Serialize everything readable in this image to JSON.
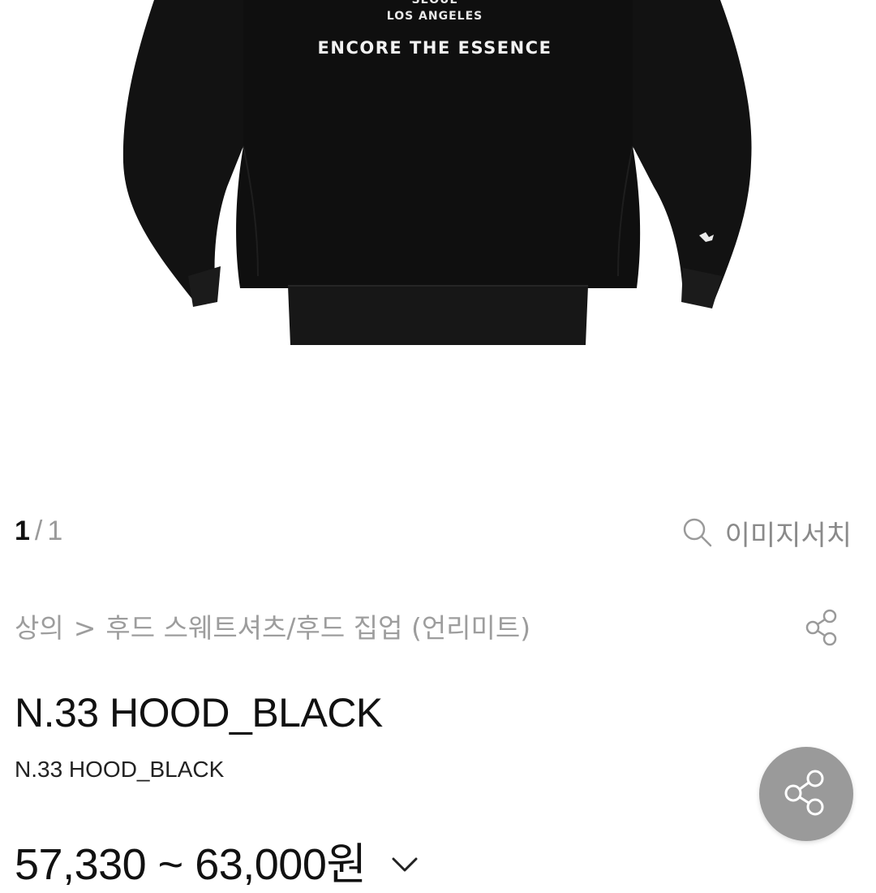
{
  "product_image": {
    "print_line_1": "SEOUL",
    "print_line_2": "LOS ANGELES",
    "print_line_3": "ENCORE THE ESSENCE"
  },
  "pager": {
    "current": "1",
    "separator": "/",
    "total": "1"
  },
  "image_search": {
    "label": "이미지서치",
    "icon": "search-icon"
  },
  "breadcrumb": {
    "category": "상의",
    "separator": ">",
    "subcategory": "후드 스웨트셔츠/후드 집업 (언리미트)"
  },
  "product": {
    "title": "N.33 HOOD_BLACK",
    "subtitle": "N.33 HOOD_BLACK",
    "price": "57,330 ~ 63,000원"
  },
  "icons": {
    "share": "share-icon",
    "dropdown": "chevron-down-icon"
  },
  "colors": {
    "garment": "#111111",
    "fab_background": "#9a9a9a",
    "muted_text": "#9d9d9d"
  }
}
